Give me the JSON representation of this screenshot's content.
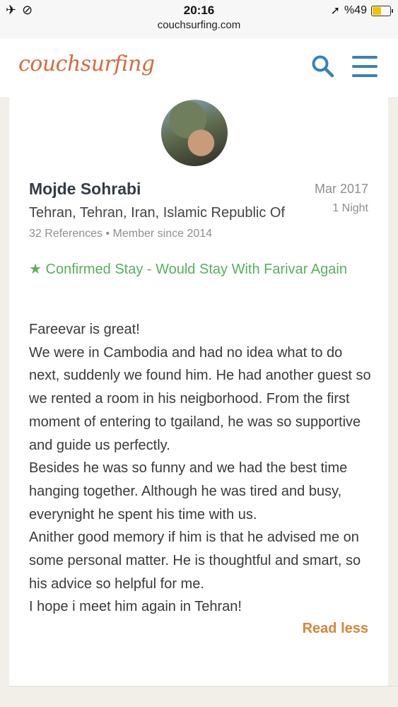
{
  "statusbar": {
    "time": "20:16",
    "url": "couchsurfing.com",
    "battery_percent": "%49",
    "battery_level": 0.49,
    "icons": [
      "airplane-icon",
      "link-icon",
      "location-arrow-icon",
      "battery-icon"
    ]
  },
  "header": {
    "logo": "couchsurfing",
    "icons": [
      "search-icon",
      "hamburger-menu-icon"
    ],
    "accent_color": "#3a80ba",
    "logo_color": "#d86a3c"
  },
  "reference": {
    "name": "Mojde Sohrabi",
    "location": "Tehran, Tehran, Iran, Islamic Republic Of",
    "meta": "32 References • Member since 2014",
    "date": "Mar 2017",
    "nights": "1 Night",
    "confirmed": "Confirmed Stay - Would Stay With Farivar Again",
    "confirmed_color": "#5aaf5e",
    "review_lines": [
      "Fareevar is great!",
      "We were in Cambodia and had no idea what to do next, suddenly we found him. He had another guest so we rented a room in his neigborhood. From the first moment of entering to tgailand, he was so supportive and guide us perfectly.",
      "Besides he was so funny and we had the best time hanging together. Although he was tired and busy, everynight he spent his time with us.",
      "Anither good memory if him is that he advised me on some personal matter. He is thoughtful and smart, so his advice so helpful for me.",
      "I hope i meet him again in Tehran!"
    ],
    "read_less": "Read less",
    "read_less_color": "#d4863b"
  }
}
